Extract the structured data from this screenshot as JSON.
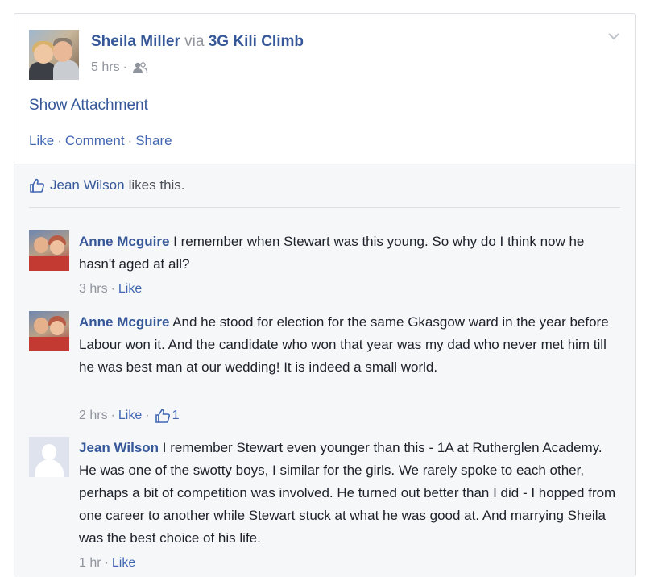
{
  "post": {
    "author": "Sheila Miller",
    "via_text": "via",
    "page": "3G Kili Climb",
    "time": "5 hrs",
    "meta_sep": "·",
    "audience_icon": "friends-icon",
    "attachment_link": "Show Attachment",
    "actions": {
      "like": "Like",
      "comment": "Comment",
      "share": "Share",
      "sep": "·"
    }
  },
  "likes": {
    "icon": "thumbs-up-icon",
    "name": "Jean Wilson",
    "suffix": "likes this."
  },
  "comments": [
    {
      "author": "Anne Mcguire",
      "text": "I remember when Stewart was this young. So why do I think now he hasn't aged at all?",
      "time": "3 hrs",
      "like": "Like"
    },
    {
      "author": "Anne Mcguire",
      "text": "And he stood for election for the same Gkasgow ward in the year before Labour won it. And the candidate who won that year was my dad who never met him till he was best man at our wedding! It is indeed a small world.",
      "time": "2 hrs",
      "like": "Like",
      "like_count": "1"
    },
    {
      "author": "Jean Wilson",
      "text": "I remember Stewart even younger than this - 1A at Rutherglen Academy. He was one of the swotty boys, I similar for the girls. We rarely spoke to each other, perhaps a bit of competition was involved. He turned out better than I did - I hopped from one career to another while Stewart stuck at what he was good at. And marrying Sheila was the best choice of his life.",
      "time": "1 hr",
      "like": "Like"
    }
  ],
  "colors": {
    "link": "#365899",
    "meta": "#90949c",
    "feedback_bg": "#f6f7f9"
  }
}
